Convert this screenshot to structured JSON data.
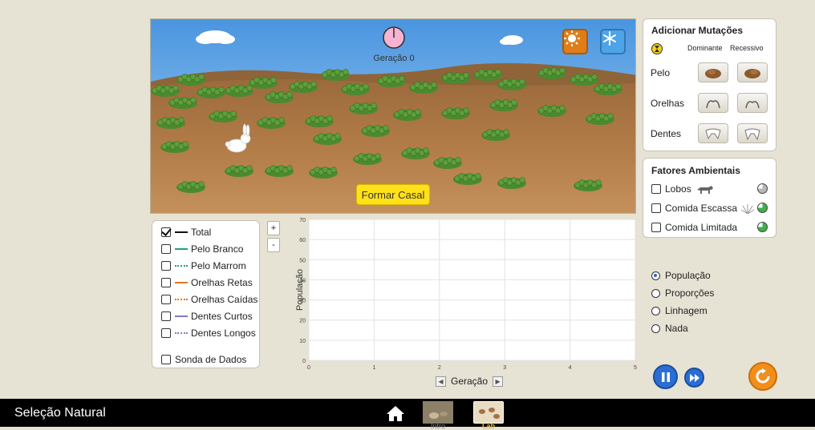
{
  "scene": {
    "generation_label": "Geração 0",
    "mate_button": "Formar Casal",
    "summer_icon": "sun-icon",
    "winter_icon": "snowflake-icon",
    "colors": {
      "sky": "#5aa0e0",
      "ground": "#b07844",
      "bush": "#5f9e3c"
    }
  },
  "mutations": {
    "title": "Adicionar Mutações",
    "dominant_label": "Dominante",
    "recessive_label": "Recessivo",
    "traits": [
      {
        "label": "Pelo",
        "icon": "fur-icon"
      },
      {
        "label": "Orelhas",
        "icon": "ears-icon"
      },
      {
        "label": "Dentes",
        "icon": "teeth-icon"
      }
    ]
  },
  "environment": {
    "title": "Fatores Ambientais",
    "factors": [
      {
        "label": "Lobos",
        "checked": false,
        "indicator": "#b8b8b8"
      },
      {
        "label": "Comida Escassa",
        "checked": false,
        "indicator": "#3fb04a"
      },
      {
        "label": "Comida Limitada",
        "checked": false,
        "indicator": "#3fb04a"
      }
    ]
  },
  "legend": {
    "items": [
      {
        "label": "Total",
        "checked": true,
        "color": "#111111",
        "style": "solid"
      },
      {
        "label": "Pelo Branco",
        "checked": false,
        "color": "#1fa37a",
        "style": "solid"
      },
      {
        "label": "Pelo Marrom",
        "checked": false,
        "color": "#1fa37a",
        "style": "dotted"
      },
      {
        "label": "Orelhas Retas",
        "checked": false,
        "color": "#e8741a",
        "style": "solid"
      },
      {
        "label": "Orelhas Caídas",
        "checked": false,
        "color": "#e8741a",
        "style": "dotted"
      },
      {
        "label": "Dentes Curtos",
        "checked": false,
        "color": "#8a78c2",
        "style": "solid"
      },
      {
        "label": "Dentes Longos",
        "checked": false,
        "color": "#8a78c2",
        "style": "dotted"
      }
    ],
    "data_probe": {
      "label": "Sonda de Dados",
      "checked": false
    },
    "zoom_in": "+",
    "zoom_out": "-"
  },
  "chart_data": {
    "type": "line",
    "xlabel": "Geração",
    "ylabel": "População",
    "xlim": [
      0,
      5
    ],
    "ylim": [
      0,
      70
    ],
    "x_ticks": [
      "0",
      "1",
      "2",
      "3",
      "4",
      "5"
    ],
    "y_ticks": [
      "0",
      "10",
      "20",
      "30",
      "40",
      "50",
      "60",
      "70"
    ],
    "grid": true,
    "series": []
  },
  "graph_options": {
    "selected": "População",
    "options": [
      "População",
      "Proporções",
      "Linhagem",
      "Nada"
    ]
  },
  "playback": {
    "pause_icon": "pause-icon",
    "step_icon": "step-forward-icon",
    "reset_icon": "reset-icon"
  },
  "navbar": {
    "title": "Seleção Natural",
    "home_icon": "home-icon",
    "screens": [
      {
        "label": "Intro",
        "active": false
      },
      {
        "label": "Lab",
        "active": true
      }
    ]
  }
}
